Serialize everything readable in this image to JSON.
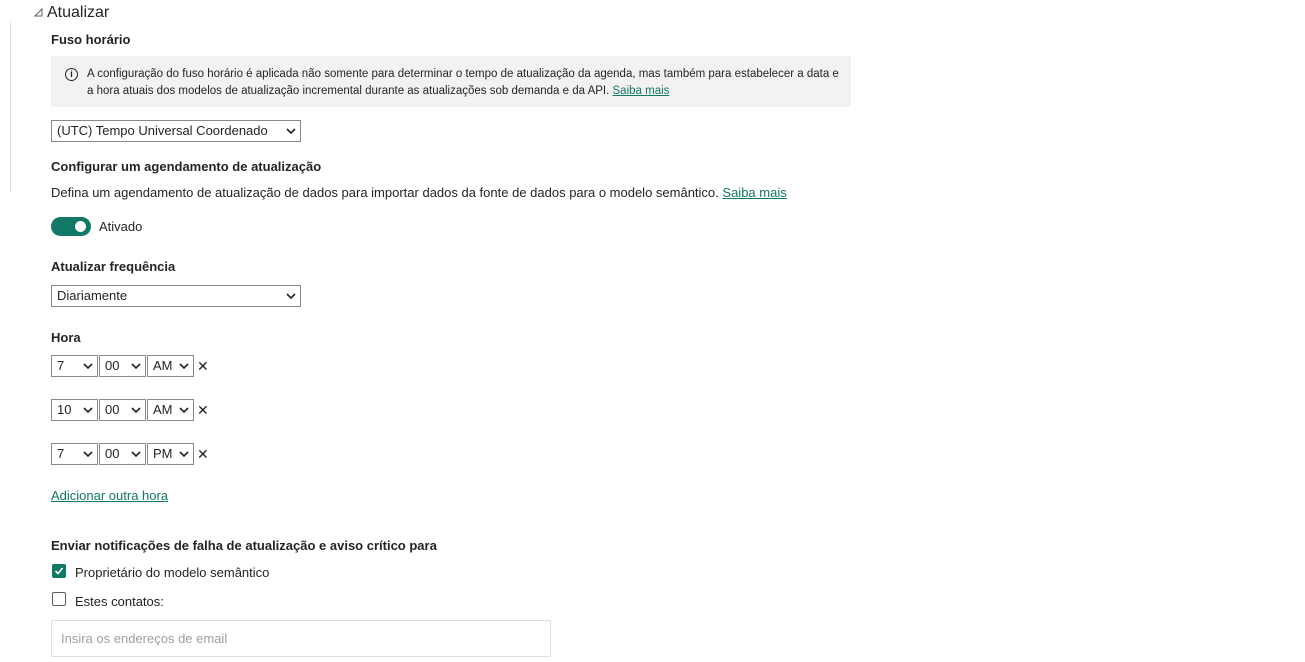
{
  "section": {
    "title": "Atualizar"
  },
  "timezone": {
    "label": "Fuso horário",
    "info_text": "A configuração do fuso horário é aplicada não somente para determinar o tempo de atualização da agenda, mas também para estabelecer a data e a hora atuais dos modelos de atualização incremental durante as atualizações sob demanda e da API.",
    "info_link": "Saiba mais",
    "selected": "(UTC) Tempo Universal Coordenado"
  },
  "schedule": {
    "heading": "Configurar um agendamento de atualização",
    "description": "Defina um agendamento de atualização de dados para importar dados da fonte de dados para o modelo semântico.",
    "description_link": "Saiba mais",
    "toggle_label": "Ativado",
    "toggle_on": true
  },
  "frequency": {
    "label": "Atualizar frequência",
    "selected": "Diariamente"
  },
  "time": {
    "label": "Hora",
    "slots": [
      {
        "hour": "7",
        "minute": "00",
        "period": "AM"
      },
      {
        "hour": "10",
        "minute": "00",
        "period": "AM"
      },
      {
        "hour": "7",
        "minute": "00",
        "period": "PM"
      }
    ],
    "add_link": "Adicionar outra hora"
  },
  "notifications": {
    "heading": "Enviar notificações de falha de atualização e aviso crítico para",
    "owner_label": "Proprietário do modelo semântico",
    "owner_checked": true,
    "contacts_label": "Estes contatos:",
    "contacts_checked": false,
    "email_placeholder": "Insira os endereços de email"
  },
  "colors": {
    "accent": "#117865",
    "text": "#252423",
    "info_bg": "#f3f2f1"
  }
}
